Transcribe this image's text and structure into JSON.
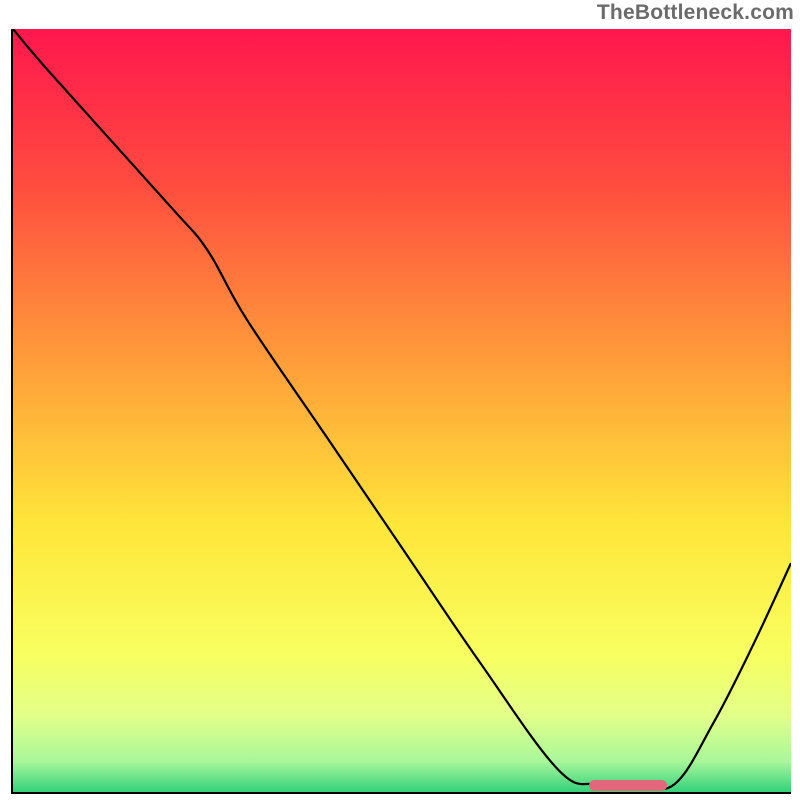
{
  "watermark": "TheBottleneck.com",
  "chart_data": {
    "type": "line",
    "title": "",
    "xlabel": "",
    "ylabel": "",
    "xlim": [
      0,
      100
    ],
    "ylim": [
      0,
      100
    ],
    "x": [
      0,
      5,
      20,
      25,
      30,
      40,
      50,
      60,
      70,
      75,
      80,
      85,
      90,
      95,
      100
    ],
    "values": [
      100,
      94,
      77,
      71,
      62,
      47,
      32,
      17,
      3,
      1,
      1,
      1,
      9,
      19,
      30
    ],
    "minimum_band": {
      "x_start": 74,
      "x_end": 84,
      "y": 0.8
    },
    "gradient_stops": [
      {
        "pos": 0.0,
        "color": "#ff174e"
      },
      {
        "pos": 0.2,
        "color": "#ff4b3f"
      },
      {
        "pos": 0.45,
        "color": "#ffa23a"
      },
      {
        "pos": 0.65,
        "color": "#ffe63a"
      },
      {
        "pos": 0.82,
        "color": "#f8ff60"
      },
      {
        "pos": 0.9,
        "color": "#e3ff8a"
      },
      {
        "pos": 0.96,
        "color": "#a8f79a"
      },
      {
        "pos": 1.0,
        "color": "#34d17c"
      }
    ]
  }
}
